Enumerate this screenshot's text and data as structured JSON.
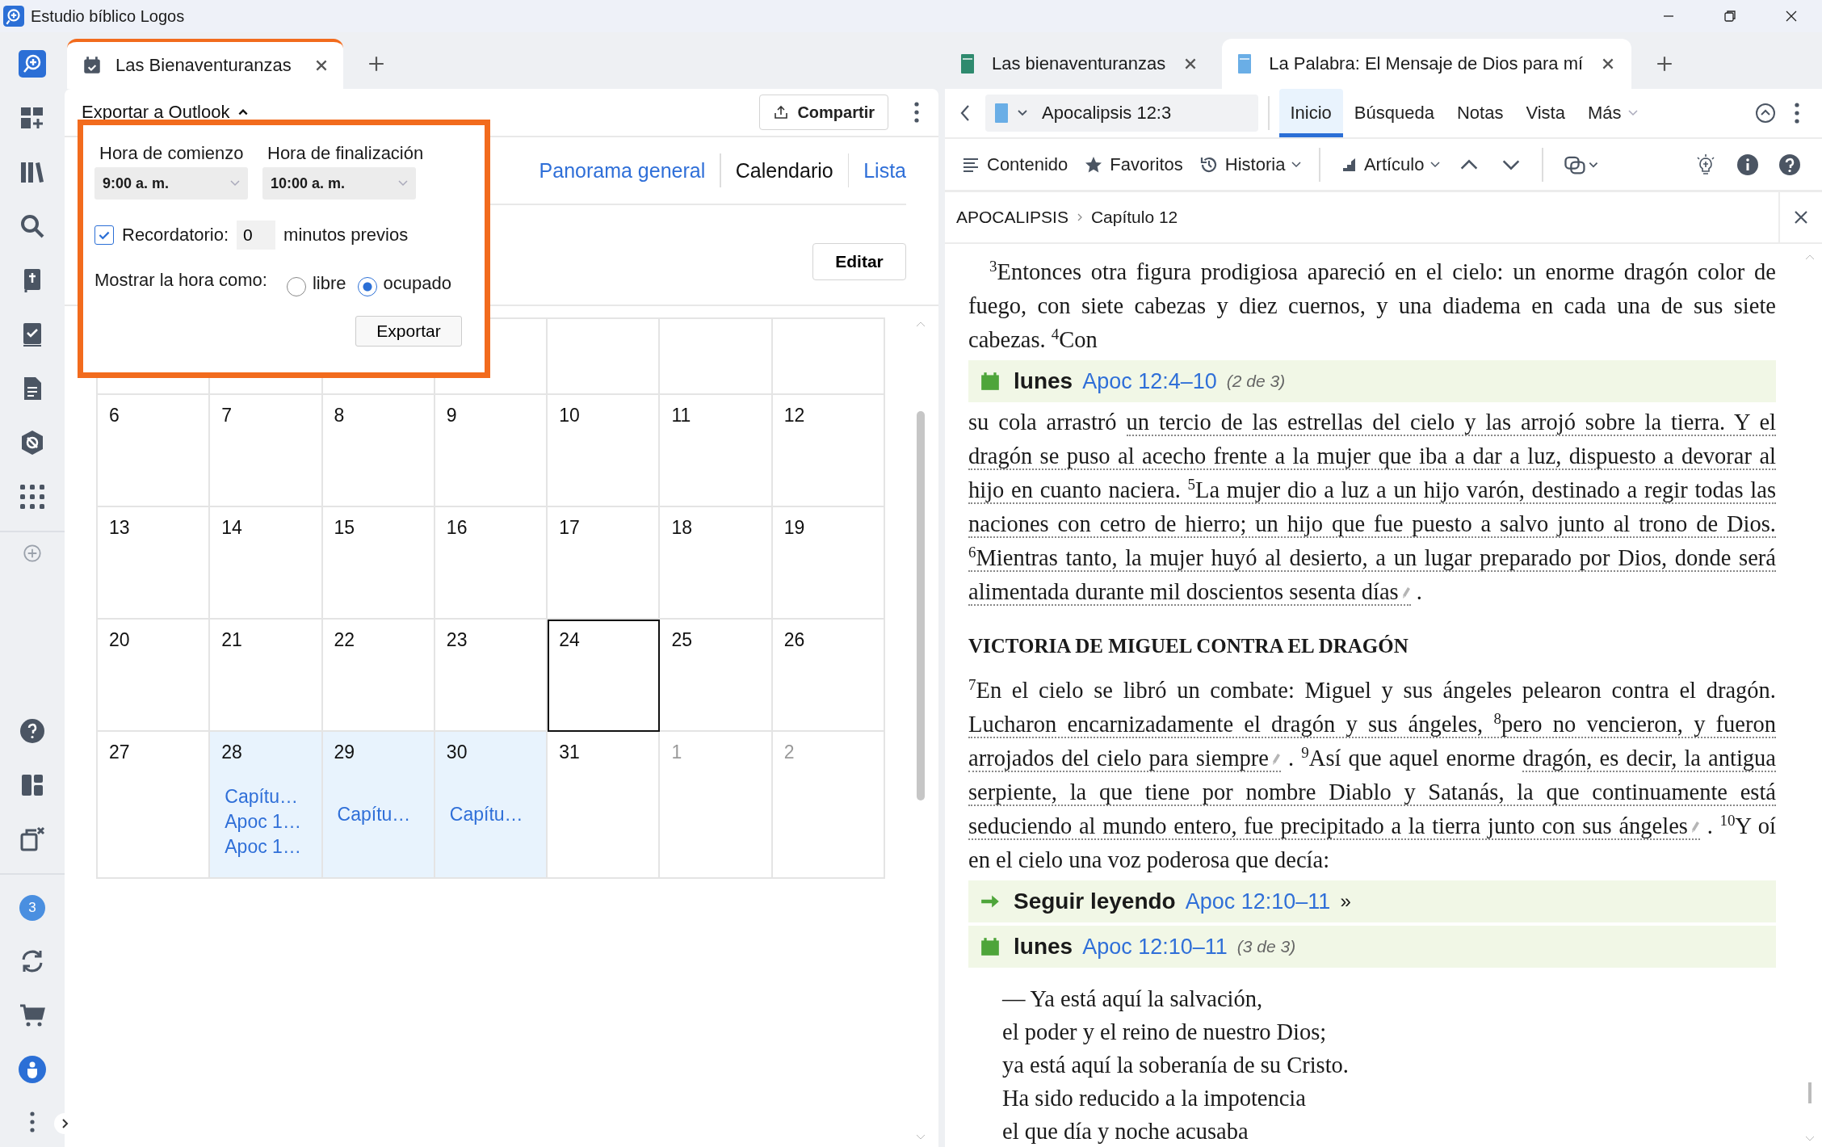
{
  "window": {
    "title": "Estudio bíblico Logos"
  },
  "sidebar": {
    "notification_count": "3"
  },
  "left_pane": {
    "tabs": [
      {
        "label": "Las Bienaventuranzas",
        "selected": true
      }
    ],
    "export": {
      "label": "Exportar a Outlook",
      "expanded": true,
      "start_label": "Hora de comienzo",
      "start_value": "9:00 a. m.",
      "end_label": "Hora de finalización",
      "end_value": "10:00 a. m.",
      "reminder": {
        "label": "Recordatorio:",
        "checked": true,
        "value": "0",
        "suffix": "minutos previos"
      },
      "show_as": {
        "label": "Mostrar la hora como:",
        "options": [
          {
            "label": "libre",
            "selected": false
          },
          {
            "label": "ocupado",
            "selected": true
          }
        ]
      },
      "button": "Exportar"
    },
    "share_button": "Compartir",
    "views": [
      {
        "label": "Panorama general",
        "selected": false
      },
      {
        "label": "Calendario",
        "selected": true
      },
      {
        "label": "Lista",
        "selected": false
      }
    ],
    "edit_button": "Editar",
    "calendar": {
      "weeks": [
        [
          {
            "day": "6",
            "outside": false,
            "today": false
          },
          {
            "day": "7",
            "outside": false,
            "today": false
          },
          {
            "day": "8",
            "outside": false,
            "today": false
          },
          {
            "day": "9",
            "outside": false,
            "today": false
          },
          {
            "day": "10",
            "outside": false,
            "today": false
          },
          {
            "day": "11",
            "outside": false,
            "today": false
          },
          {
            "day": "12",
            "outside": false,
            "today": false
          }
        ],
        [
          {
            "day": "13",
            "outside": false,
            "today": false
          },
          {
            "day": "14",
            "outside": false,
            "today": false
          },
          {
            "day": "15",
            "outside": false,
            "today": false
          },
          {
            "day": "16",
            "outside": false,
            "today": false
          },
          {
            "day": "17",
            "outside": false,
            "today": false
          },
          {
            "day": "18",
            "outside": false,
            "today": false
          },
          {
            "day": "19",
            "outside": false,
            "today": false
          }
        ],
        [
          {
            "day": "20",
            "outside": false,
            "today": false
          },
          {
            "day": "21",
            "outside": false,
            "today": false
          },
          {
            "day": "22",
            "outside": false,
            "today": false
          },
          {
            "day": "23",
            "outside": false,
            "today": false
          },
          {
            "day": "24",
            "outside": false,
            "today": true
          },
          {
            "day": "25",
            "outside": false,
            "today": false
          },
          {
            "day": "26",
            "outside": false,
            "today": false
          }
        ],
        [
          {
            "day": "27",
            "outside": false,
            "today": false
          },
          {
            "day": "28",
            "outside": false,
            "today": false,
            "events": [
              "Capítu…",
              "Apoc 1…",
              "Apoc 1…"
            ]
          },
          {
            "day": "29",
            "outside": false,
            "today": false,
            "events": [
              "Capítu…"
            ]
          },
          {
            "day": "30",
            "outside": false,
            "today": false,
            "events": [
              "Capítu…"
            ]
          },
          {
            "day": "31",
            "outside": false,
            "today": false
          },
          {
            "day": "1",
            "outside": true,
            "today": false
          },
          {
            "day": "2",
            "outside": true,
            "today": false
          }
        ]
      ]
    }
  },
  "right_pane": {
    "tabs": [
      {
        "label": "Las bienaventuranzas",
        "selected": false
      },
      {
        "label": "La Palabra: El Mensaje de Dios para mí",
        "selected": true
      }
    ],
    "reference": "Apocalipsis 12:3",
    "menu": [
      {
        "label": "Inicio",
        "selected": true,
        "kind": "tab"
      },
      {
        "label": "Búsqueda",
        "selected": false,
        "kind": "tab"
      },
      {
        "label": "Notas",
        "selected": false,
        "kind": "tab"
      },
      {
        "label": "Vista",
        "selected": false,
        "kind": "tab"
      },
      {
        "label": "Más",
        "selected": false,
        "kind": "dropdown"
      }
    ],
    "toolbar": [
      "Contenido",
      "Favoritos",
      "Historia",
      "Artículo"
    ],
    "breadcrumb": [
      "APOCALIPSIS",
      "Capítulo 12"
    ],
    "body": [
      {
        "kind": "paragraph",
        "parts": [
          {
            "text": "$^{3}$Entonces otra figura prodigiosa apareció en el cielo: un enorme dragón color de fuego, con siete cabezas y diez cuernos, y una diadema en cada una de sus siete cabezas. $^{4}$Con",
            "underlined": false,
            "note": false
          }
        ]
      },
      {
        "kind": "plan",
        "day": "lunes",
        "link": "Apoc 12:4–10",
        "progress": "(2 de 3)"
      },
      {
        "kind": "paragraph",
        "parts": [
          {
            "text": "su cola arrastró ",
            "underlined": false,
            "note": false
          },
          {
            "text": "un tercio de las estrellas del cielo y las arrojó sobre la tierra. Y el dragón se puso al acecho frente a la mujer que iba a dar a luz, dispuesto a devorar al hijo en cuanto naciera. $^{5}$La mujer dio a luz a un hijo varón, destinado a regir todas las naciones con cetro de hierro; un hijo que fue puesto a salvo junto al trono de Dios. $^{6}$Mientras tanto, la mujer huyó al desierto, a un lugar preparado por Dios, donde será alimentada durante mil doscientos sesenta días",
            "underlined": true,
            "note": true
          },
          {
            "text": " .",
            "underlined": false,
            "note": false
          }
        ]
      },
      {
        "kind": "heading",
        "text": "VICTORIA DE MIGUEL CONTRA EL DRAGÓN"
      },
      {
        "kind": "paragraph",
        "parts": [
          {
            "text": "$^{7}$En el cielo se libró un combate: Miguel y sus ángeles pelearon contra el dragón. ",
            "underlined": false,
            "note": false
          },
          {
            "text": "Lucharon encarnizadamente el dragón y sus ángeles, $^{8}$pero no vencieron, y fueron arrojados del cielo para siempre",
            "underlined": true,
            "note": true
          },
          {
            "text": " . $^{9}$Así que aquel enorme ",
            "underlined": false,
            "note": false
          },
          {
            "text": "dragón, es decir, la antigua serpiente, la que tiene por nombre Diablo y Satanás, la que continuamente está seduciendo al mundo entero, fue precipitado a la tierra junto con sus ángeles",
            "underlined": true,
            "note": true
          },
          {
            "text": " . $^{10}$Y oí en el cielo una voz poderosa que decía:",
            "underlined": false,
            "note": false
          }
        ]
      },
      {
        "kind": "continue",
        "label": "Seguir leyendo",
        "link": "Apoc 12:10–11",
        "mark": "»"
      },
      {
        "kind": "plan",
        "day": "lunes",
        "link": "Apoc 12:10–11",
        "progress": "(3 de 3)"
      },
      {
        "kind": "poem",
        "lines": [
          "— Ya está aquí la salvación,",
          "el poder y el reino de nuestro Dios;",
          "ya está aquí la soberanía de su Cristo.",
          "Ha sido reducido a la impotencia",
          "el que día y noche acusaba"
        ]
      }
    ]
  }
}
